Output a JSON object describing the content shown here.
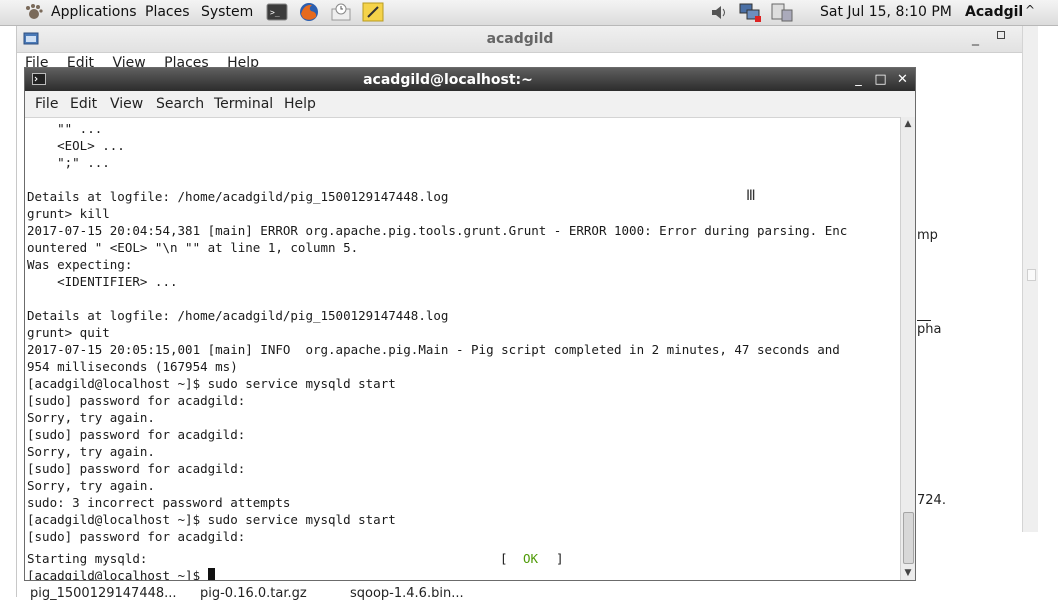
{
  "panel": {
    "menus": [
      "Applications",
      "Places",
      "System"
    ],
    "clock": "Sat Jul 15,  8:10 PM",
    "user": "Acadgil"
  },
  "bg_window": {
    "title": "acadgild",
    "menus": [
      "File",
      "Edit",
      "View",
      "Places",
      "Help"
    ],
    "fragments": [
      "mp",
      "pha",
      "724."
    ],
    "files": [
      "pig_1500129147448...",
      "pig-0.16.0.tar.gz",
      "sqoop-1.4.6.bin..."
    ]
  },
  "terminal": {
    "title": "acadgild@localhost:~",
    "menus": [
      "File",
      "Edit",
      "View",
      "Search",
      "Terminal",
      "Help"
    ],
    "lines": [
      "    \"\" ...",
      "    <EOL> ...",
      "    \";\" ...",
      "",
      "Details at logfile: /home/acadgild/pig_1500129147448.log",
      "grunt> kill",
      "2017-07-15 20:04:54,381 [main] ERROR org.apache.pig.tools.grunt.Grunt - ERROR 1000: Error during parsing. Enc",
      "ountered \" <EOL> \"\\n \"\" at line 1, column 5.",
      "Was expecting:",
      "    <IDENTIFIER> ...",
      "",
      "Details at logfile: /home/acadgild/pig_1500129147448.log",
      "grunt> quit",
      "2017-07-15 20:05:15,001 [main] INFO  org.apache.pig.Main - Pig script completed in 2 minutes, 47 seconds and",
      "954 milliseconds (167954 ms)",
      "[acadgild@localhost ~]$ sudo service mysqld start",
      "[sudo] password for acadgild:",
      "Sorry, try again.",
      "[sudo] password for acadgild:",
      "Sorry, try again.",
      "[sudo] password for acadgild:",
      "Sorry, try again.",
      "sudo: 3 incorrect password attempts",
      "[acadgild@localhost ~]$ sudo service mysqld start",
      "[sudo] password for acadgild:"
    ],
    "starting_line": "Starting mysqld:",
    "ok_open": "[  ",
    "ok_text": "OK",
    "ok_close": "  ]",
    "prompt": "[acadgild@localhost ~]$ "
  },
  "colors": {
    "terminal_titlebar": "#3a3a3a",
    "ok_green": "#4e9a06"
  }
}
